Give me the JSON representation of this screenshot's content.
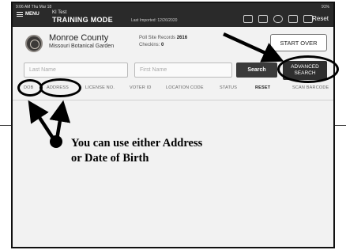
{
  "topbar": {
    "status_time": "9:06 AM  Thu Mar 18",
    "menu_label": "MENU",
    "user": "KI Test",
    "mode": "TRAINING MODE",
    "last_imported": "Last Imported: 12/26/2020",
    "system_status": "91%",
    "reset_label": "Reset",
    "icons": [
      "mail-icon",
      "printer-icon",
      "cloud-icon",
      "users-icon",
      "scan-icon"
    ]
  },
  "header": {
    "county": "Monroe County",
    "location": "Missouri Botanical Garden",
    "poll_site_records_label": "Poll Site Records",
    "poll_site_records_value": "2616",
    "checkins_label": "Checkins:",
    "checkins_value": "0",
    "start_over_label": "START OVER"
  },
  "search": {
    "last_name_placeholder": "Last Name",
    "first_name_placeholder": "First Name",
    "search_label": "Search",
    "advanced_search_label": "ADVANCED SEARCH"
  },
  "filters": [
    "DOB",
    "ADDRESS",
    "LICENSE NO.",
    "VOTER ID",
    "LOCATION CODE",
    "STATUS",
    "RESET",
    "SCAN BARCODE"
  ],
  "annotation": {
    "line1": "You can use either Address",
    "line2": "or Date of Birth"
  },
  "colors": {
    "topbar": "#2a2a2a",
    "screen": "#f2f2f2",
    "button_dark": "#3a3a3a",
    "annotation": "#000000"
  }
}
